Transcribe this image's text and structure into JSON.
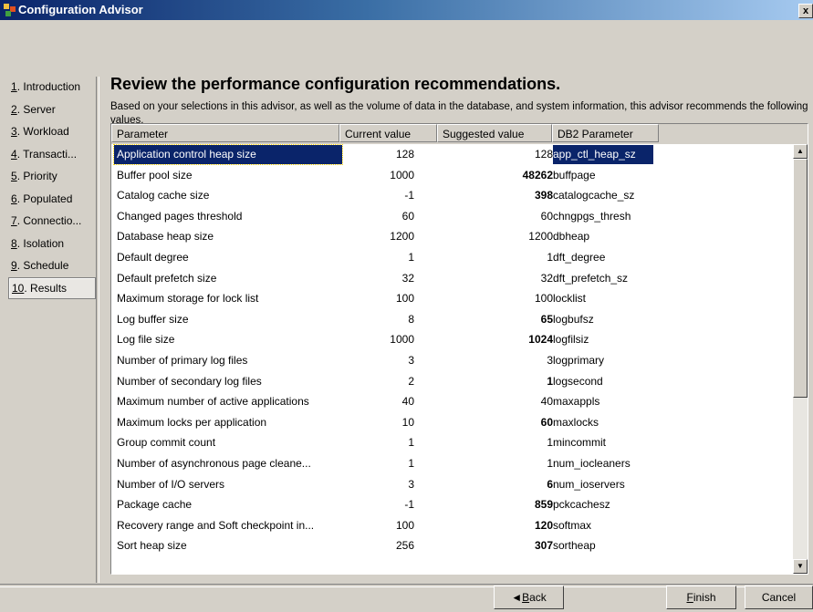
{
  "window": {
    "title": "Configuration Advisor",
    "close_glyph": "x"
  },
  "nav": [
    {
      "num": "1",
      "label": ". Introduction"
    },
    {
      "num": "2",
      "label": ". Server"
    },
    {
      "num": "3",
      "label": ". Workload"
    },
    {
      "num": "4",
      "label": ". Transacti..."
    },
    {
      "num": "5",
      "label": ". Priority"
    },
    {
      "num": "6",
      "label": ". Populated"
    },
    {
      "num": "7",
      "label": ". Connectio..."
    },
    {
      "num": "8",
      "label": ". Isolation"
    },
    {
      "num": "9",
      "label": ". Schedule"
    },
    {
      "num": "10",
      "label": ". Results"
    }
  ],
  "page": {
    "heading": "Review the performance configuration recommendations.",
    "description": "Based on your selections in this advisor, as well as the volume of data in the database, and system information, this advisor recommends the following values."
  },
  "table": {
    "headers": [
      "Parameter",
      "Current value",
      "Suggested value",
      "DB2 Parameter"
    ],
    "rows": [
      {
        "param": "Application control heap size",
        "current": "128",
        "suggested": "128",
        "db2": "app_ctl_heap_sz",
        "changed": false,
        "selected": true
      },
      {
        "param": "Buffer pool size",
        "current": "1000",
        "suggested": "48262",
        "db2": "buffpage",
        "changed": true
      },
      {
        "param": "Catalog cache size",
        "current": "-1",
        "suggested": "398",
        "db2": "catalogcache_sz",
        "changed": true
      },
      {
        "param": "Changed pages threshold",
        "current": "60",
        "suggested": "60",
        "db2": "chngpgs_thresh",
        "changed": false
      },
      {
        "param": "Database heap size",
        "current": "1200",
        "suggested": "1200",
        "db2": "dbheap",
        "changed": false
      },
      {
        "param": "Default degree",
        "current": "1",
        "suggested": "1",
        "db2": "dft_degree",
        "changed": false
      },
      {
        "param": "Default prefetch size",
        "current": "32",
        "suggested": "32",
        "db2": "dft_prefetch_sz",
        "changed": false
      },
      {
        "param": "Maximum storage for lock list",
        "current": "100",
        "suggested": "100",
        "db2": "locklist",
        "changed": false
      },
      {
        "param": "Log buffer size",
        "current": "8",
        "suggested": "65",
        "db2": "logbufsz",
        "changed": true
      },
      {
        "param": "Log file size",
        "current": "1000",
        "suggested": "1024",
        "db2": "logfilsiz",
        "changed": true
      },
      {
        "param": "Number of primary log files",
        "current": "3",
        "suggested": "3",
        "db2": "logprimary",
        "changed": false
      },
      {
        "param": "Number of secondary log files",
        "current": "2",
        "suggested": "1",
        "db2": "logsecond",
        "changed": true
      },
      {
        "param": "Maximum number of active applications",
        "current": "40",
        "suggested": "40",
        "db2": "maxappls",
        "changed": false
      },
      {
        "param": "Maximum locks per application",
        "current": "10",
        "suggested": "60",
        "db2": "maxlocks",
        "changed": true
      },
      {
        "param": "Group commit count",
        "current": "1",
        "suggested": "1",
        "db2": "mincommit",
        "changed": false
      },
      {
        "param": "Number of asynchronous page cleane...",
        "current": "1",
        "suggested": "1",
        "db2": "num_iocleaners",
        "changed": false
      },
      {
        "param": "Number of I/O servers",
        "current": "3",
        "suggested": "6",
        "db2": "num_ioservers",
        "changed": true
      },
      {
        "param": "Package cache",
        "current": "-1",
        "suggested": "859",
        "db2": "pckcachesz",
        "changed": true
      },
      {
        "param": "Recovery range and Soft checkpoint in...",
        "current": "100",
        "suggested": "120",
        "db2": "softmax",
        "changed": true
      },
      {
        "param": "Sort heap size",
        "current": "256",
        "suggested": "307",
        "db2": "sortheap",
        "changed": true
      }
    ]
  },
  "buttons": {
    "back": {
      "arrow": "◄",
      "mnemonic": "B",
      "rest": "ack"
    },
    "finish": {
      "mnemonic": "F",
      "rest": "inish"
    },
    "cancel": "Cancel"
  },
  "colors": {
    "selection": "#0a246a",
    "window_bg": "#d4d0c8"
  }
}
